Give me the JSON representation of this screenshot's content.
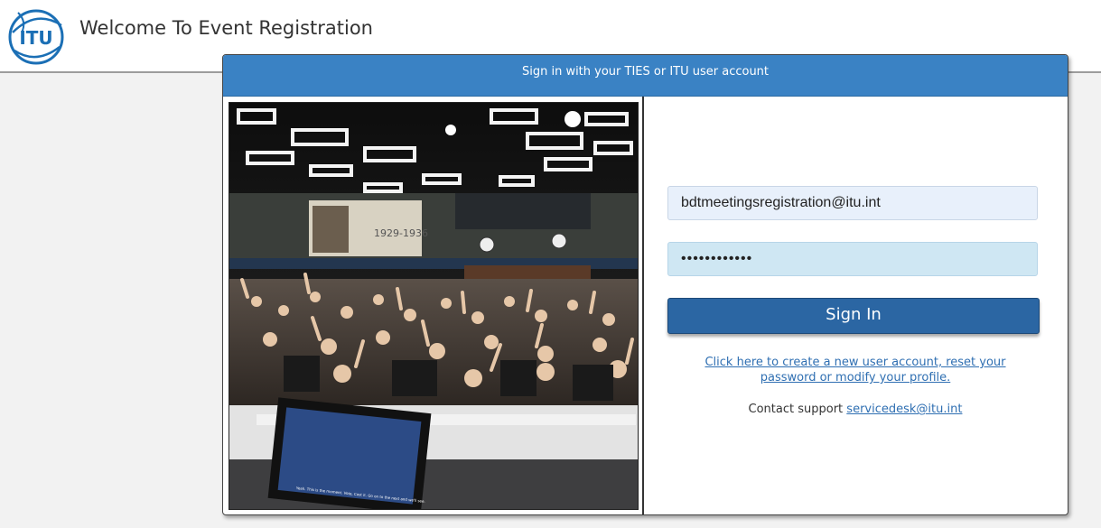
{
  "header": {
    "logo_text": "ITU",
    "title": "Welcome To Event Registration"
  },
  "panel": {
    "heading": "Sign in with your TIES or ITU user account"
  },
  "form": {
    "username_value": "bdtmeetingsregistration@itu.int",
    "password_value": "••••••••••••",
    "signin_label": "Sign In",
    "create_account_link": "Click here to create a new user account, reset your password or modify your profile.",
    "contact_label": "Contact support",
    "contact_email": "servicedesk@itu.int"
  },
  "photo": {
    "banner_year": "1929-1936",
    "screen_caption": "Yeah. This is the moment. Vote, Cast it. Go on to the next and we'll see."
  },
  "colors": {
    "accent": "#3a82c4",
    "button": "#2b66a3",
    "link": "#2f6fb2"
  }
}
